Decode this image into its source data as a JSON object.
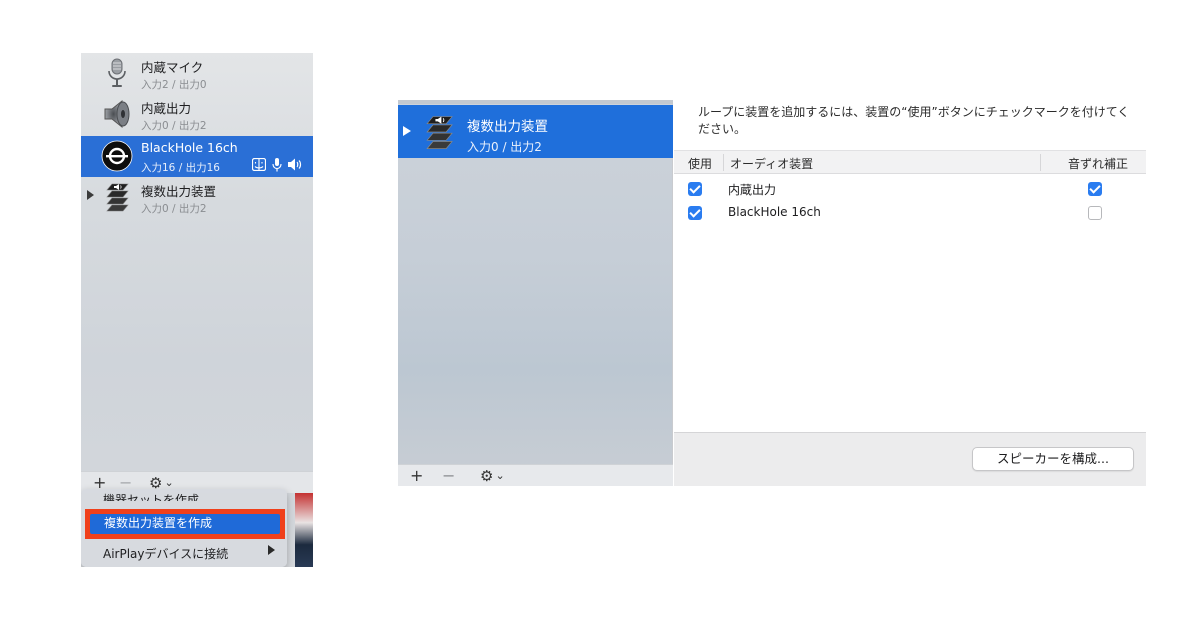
{
  "left_panel": {
    "devices": [
      {
        "name": "内蔵マイク",
        "sub": "入力2 / 出力0",
        "icon": "microphone-icon"
      },
      {
        "name": "内蔵出力",
        "sub": "入力0 / 出力2",
        "icon": "speaker-icon"
      },
      {
        "name": "BlackHole 16ch",
        "sub": "入力16 / 出力16",
        "icon": "blackhole-icon",
        "selected": true
      },
      {
        "name": "複数出力装置",
        "sub": "入力0 / 出力2",
        "icon": "multi-output-icon"
      }
    ],
    "toolbar": {
      "add": "+",
      "remove": "−",
      "gear": "⚙",
      "chevron": "⌄"
    },
    "context_menu": {
      "item_cut": "機器セットを作成",
      "item_highlighted": "複数出力装置を作成",
      "item_airplay": "AirPlayデバイスに接続"
    }
  },
  "right_window": {
    "sidebar": {
      "selected_device": {
        "name": "複数出力装置",
        "sub": "入力0 / 出力2",
        "icon": "multi-output-icon"
      },
      "toolbar": {
        "add": "+",
        "remove": "−",
        "gear": "⚙",
        "chevron": "⌄"
      }
    },
    "main": {
      "instruction": "ループに装置を追加するには、装置の“使用”ボタンにチェックマークを付けてください。",
      "columns": {
        "use": "使用",
        "device": "オーディオ装置",
        "drift": "音ずれ補正"
      },
      "rows": [
        {
          "device": "内蔵出力",
          "use": true,
          "drift": true
        },
        {
          "device": "BlackHole 16ch",
          "use": true,
          "drift": false
        }
      ],
      "configure_button": "スピーカーを構成..."
    }
  },
  "colors": {
    "selection_blue": "#2a6fd6",
    "highlight_red": "#f0401b",
    "checkbox_blue": "#2a7cf0"
  }
}
